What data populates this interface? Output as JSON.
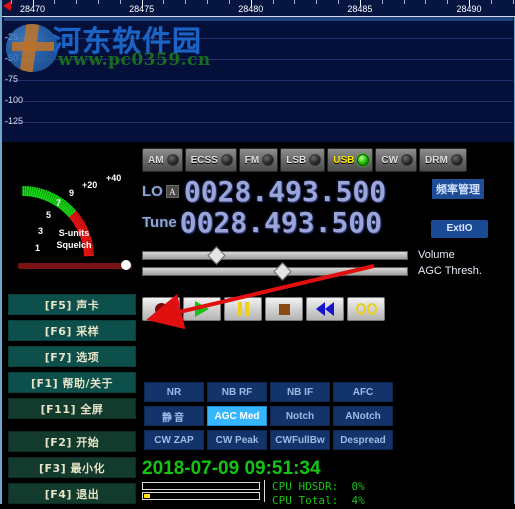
{
  "spectrum": {
    "freq_ticks": [
      28470,
      28475,
      28480,
      28485,
      28490
    ],
    "y_labels": [
      "-25",
      "-50",
      "-75",
      "-100",
      "-125"
    ],
    "marker_name": "tuning-marker"
  },
  "watermark": {
    "site_cn": "河东软件园",
    "site_url": "www.pc0359.cn"
  },
  "smeter": {
    "scale_numbers": [
      "1",
      "3",
      "5",
      "7",
      "9",
      "+20",
      "+40"
    ],
    "caption_units": "S-units",
    "caption_squelch": "Squelch"
  },
  "modes": [
    {
      "label": "AM",
      "active": false
    },
    {
      "label": "ECSS",
      "active": false
    },
    {
      "label": "FM",
      "active": false
    },
    {
      "label": "LSB",
      "active": false
    },
    {
      "label": "USB",
      "active": true
    },
    {
      "label": "CW",
      "active": false
    },
    {
      "label": "DRM",
      "active": false
    }
  ],
  "frequency": {
    "lo_label": "LO",
    "lo_badge": "A",
    "lo_value": "0028.493.500",
    "tune_label": "Tune",
    "tune_value": "0028.493.500",
    "freq_manager_button": "频率管理",
    "extio_button": "ExtIO"
  },
  "sliders": [
    {
      "label": "Volume",
      "percent": 27
    },
    {
      "label": "AGC Thresh.",
      "percent": 53
    }
  ],
  "transport": [
    {
      "name": "record-button",
      "icon": "record-icon"
    },
    {
      "name": "play-button",
      "icon": "play-icon"
    },
    {
      "name": "pause-button",
      "icon": "pause-icon"
    },
    {
      "name": "stop-button",
      "icon": "stop-icon"
    },
    {
      "name": "rewind-button",
      "icon": "rewind-icon"
    },
    {
      "name": "loop-button",
      "icon": "loop-icon"
    }
  ],
  "sidebar": [
    {
      "label": "[F5]  声卡",
      "name": "soundcard"
    },
    {
      "label": "[F6]  采样",
      "name": "sampling"
    },
    {
      "label": "[F7]  选项",
      "name": "options"
    },
    {
      "label": "[F1]  帮助/关于",
      "name": "help-about"
    },
    {
      "label": "[F11]  全屏",
      "name": "fullscreen"
    },
    {
      "label": "[F2]  开始",
      "name": "start"
    },
    {
      "label": "[F3]  最小化",
      "name": "minimize"
    },
    {
      "label": "[F4]  退出",
      "name": "exit"
    }
  ],
  "dsp": [
    {
      "label": "NR",
      "active": false
    },
    {
      "label": "NB RF",
      "active": false
    },
    {
      "label": "NB IF",
      "active": false
    },
    {
      "label": "AFC",
      "active": false
    },
    {
      "label": "静音",
      "active": false
    },
    {
      "label": "AGC Med",
      "active": true
    },
    {
      "label": "Notch",
      "active": false
    },
    {
      "label": "ANotch",
      "active": false
    },
    {
      "label": "CW ZAP",
      "active": false
    },
    {
      "label": "CW Peak",
      "active": false
    },
    {
      "label": "CWFullBw",
      "active": false
    },
    {
      "label": "Despread",
      "active": false
    }
  ],
  "status": {
    "datetime": "2018-07-09 09:51:34",
    "cpu_hdsdr": "CPU HDSDR:  0%",
    "cpu_total": "CPU Total:  4%",
    "bar1_percent": 0,
    "bar2_percent": 5
  },
  "colors": {
    "accent_active": "#35b6ff",
    "led_on": "#16b200",
    "mode_on_text": "#ffe800",
    "clock_green": "#13c513",
    "sidebar_bg": "#0d4f4b",
    "dsp_bg": "#12346b",
    "annotation_red": "#e01010"
  }
}
